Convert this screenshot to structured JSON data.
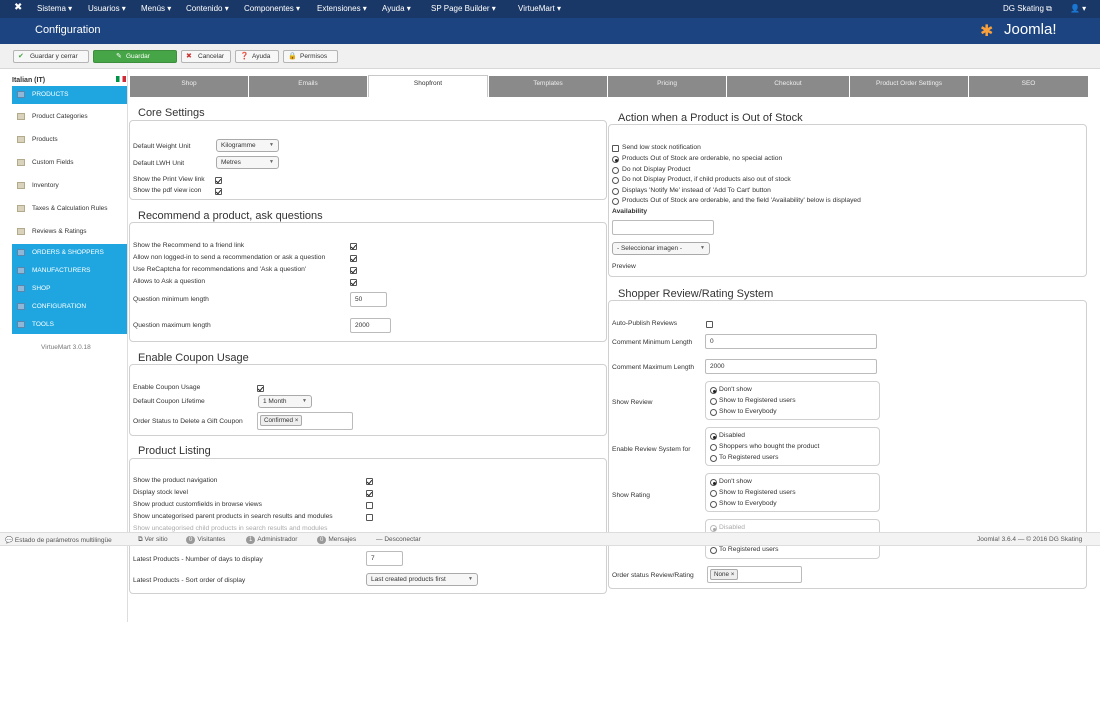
{
  "topnav": {
    "menus": [
      "Sistema ▾",
      "Usuarios ▾",
      "Menús ▾",
      "Contenido ▾",
      "Componentes ▾",
      "Extensiones ▾",
      "Ayuda ▾",
      "SP Page Builder ▾",
      "VirtueMart ▾"
    ],
    "site": "DG Skating ⧉",
    "user": "👤 ▾"
  },
  "header": {
    "title": "Configuration",
    "brand": "Joomla!"
  },
  "toolbar": {
    "save_close": "Guardar y cerrar",
    "save": "Guardar",
    "cancel": "Cancelar",
    "help": "Ayuda",
    "permissions": "Permisos"
  },
  "sidebar": {
    "language": "Italian (IT)",
    "items": [
      "PRODUCTS",
      "Product Categories",
      "Products",
      "Custom Fields",
      "Inventory",
      "Taxes & Calculation Rules",
      "Reviews & Ratings",
      "ORDERS & SHOPPERS",
      "MANUFACTURERS",
      "SHOP",
      "CONFIGURATION",
      "TOOLS"
    ],
    "version": "VirtueMart 3.0.18"
  },
  "tabs": [
    "Shop",
    "Emails",
    "Shopfront",
    "Templates",
    "Pricing",
    "Checkout",
    "Product Order Settings",
    "SEO"
  ],
  "core": {
    "title": "Core Settings",
    "weight_label": "Default Weight Unit",
    "weight_value": "Kilogramme",
    "lwh_label": "Default LWH Unit",
    "lwh_value": "Metres",
    "print_label": "Show the Print View link",
    "pdf_label": "Show the pdf view icon"
  },
  "recommend": {
    "title": "Recommend a product, ask questions",
    "r1": "Show the Recommend to a friend link",
    "r2": "Allow non logged-in to send a recommendation or ask a question",
    "r3": "Use ReCaptcha for recommendations and 'Ask a question'",
    "r4": "Allows to Ask a question",
    "min_label": "Question minimum length",
    "min_value": "50",
    "max_label": "Question maximum length",
    "max_value": "2000"
  },
  "coupon": {
    "title": "Enable Coupon Usage",
    "enable_label": "Enable Coupon Usage",
    "lifetime_label": "Default Coupon Lifetime",
    "lifetime_value": "1 Month",
    "delete_label": "Order Status to Delete a Gift Coupon",
    "delete_chip": "Confirmed ×"
  },
  "listing": {
    "title": "Product Listing",
    "l1": "Show the product navigation",
    "l2": "Display stock level",
    "l3": "Show product customfields in browse views",
    "l4": "Show uncategorised parent products in search results and modules",
    "l5": "Show uncategorised child products in search results and modules",
    "days_label": "Latest Products - Number of days to display",
    "days_value": "7",
    "sort_label": "Latest Products - Sort order of display",
    "sort_value": "Last created products first"
  },
  "oos": {
    "title": "Action when a Product is Out of Stock",
    "notify": "Send low stock notification",
    "o1": "Products Out of Stock are orderable, no special action",
    "o2": "Do not Display Product",
    "o3": "Do not Display Product, if child products also out of stock",
    "o4": "Displays 'Notify Me' instead of 'Add To Cart' button",
    "o5": "Products Out of Stock are orderable, and the field 'Availability' below is displayed",
    "avail": "Availability",
    "img_select": "- Seleccionar imagen -",
    "preview": "Preview"
  },
  "review": {
    "title": "Shopper Review/Rating System",
    "autopub": "Auto-Publish Reviews",
    "cmin_label": "Comment Minimum Length",
    "cmin_value": "0",
    "cmax_label": "Comment Maximum Length",
    "cmax_value": "2000",
    "show_review": "Show Review",
    "sr": [
      "Don't show",
      "Show to Registered users",
      "Show to Everybody"
    ],
    "enable_label": "Enable Review System for",
    "er": [
      "Disabled",
      "Shoppers who bought the product",
      "To Registered users"
    ],
    "show_rating": "Show Rating",
    "rt": [
      "Don't show",
      "Show to Registered users",
      "Show to Everybody"
    ],
    "hidden": [
      "Disabled",
      "To Registered users"
    ],
    "status_label": "Order status Review/Rating",
    "status_chip": "None ×"
  },
  "status": {
    "multilang": "Estado de parámetros multilingüe",
    "site": "Ver sitio",
    "visitors": "Visitantes",
    "visitors_n": "0",
    "admin": "Administrador",
    "admin_n": "1",
    "messages": "Mensajes",
    "messages_n": "0",
    "logout": "Desconectar",
    "version": "Joomla! 3.6.4 — © 2016 DG Skating"
  }
}
